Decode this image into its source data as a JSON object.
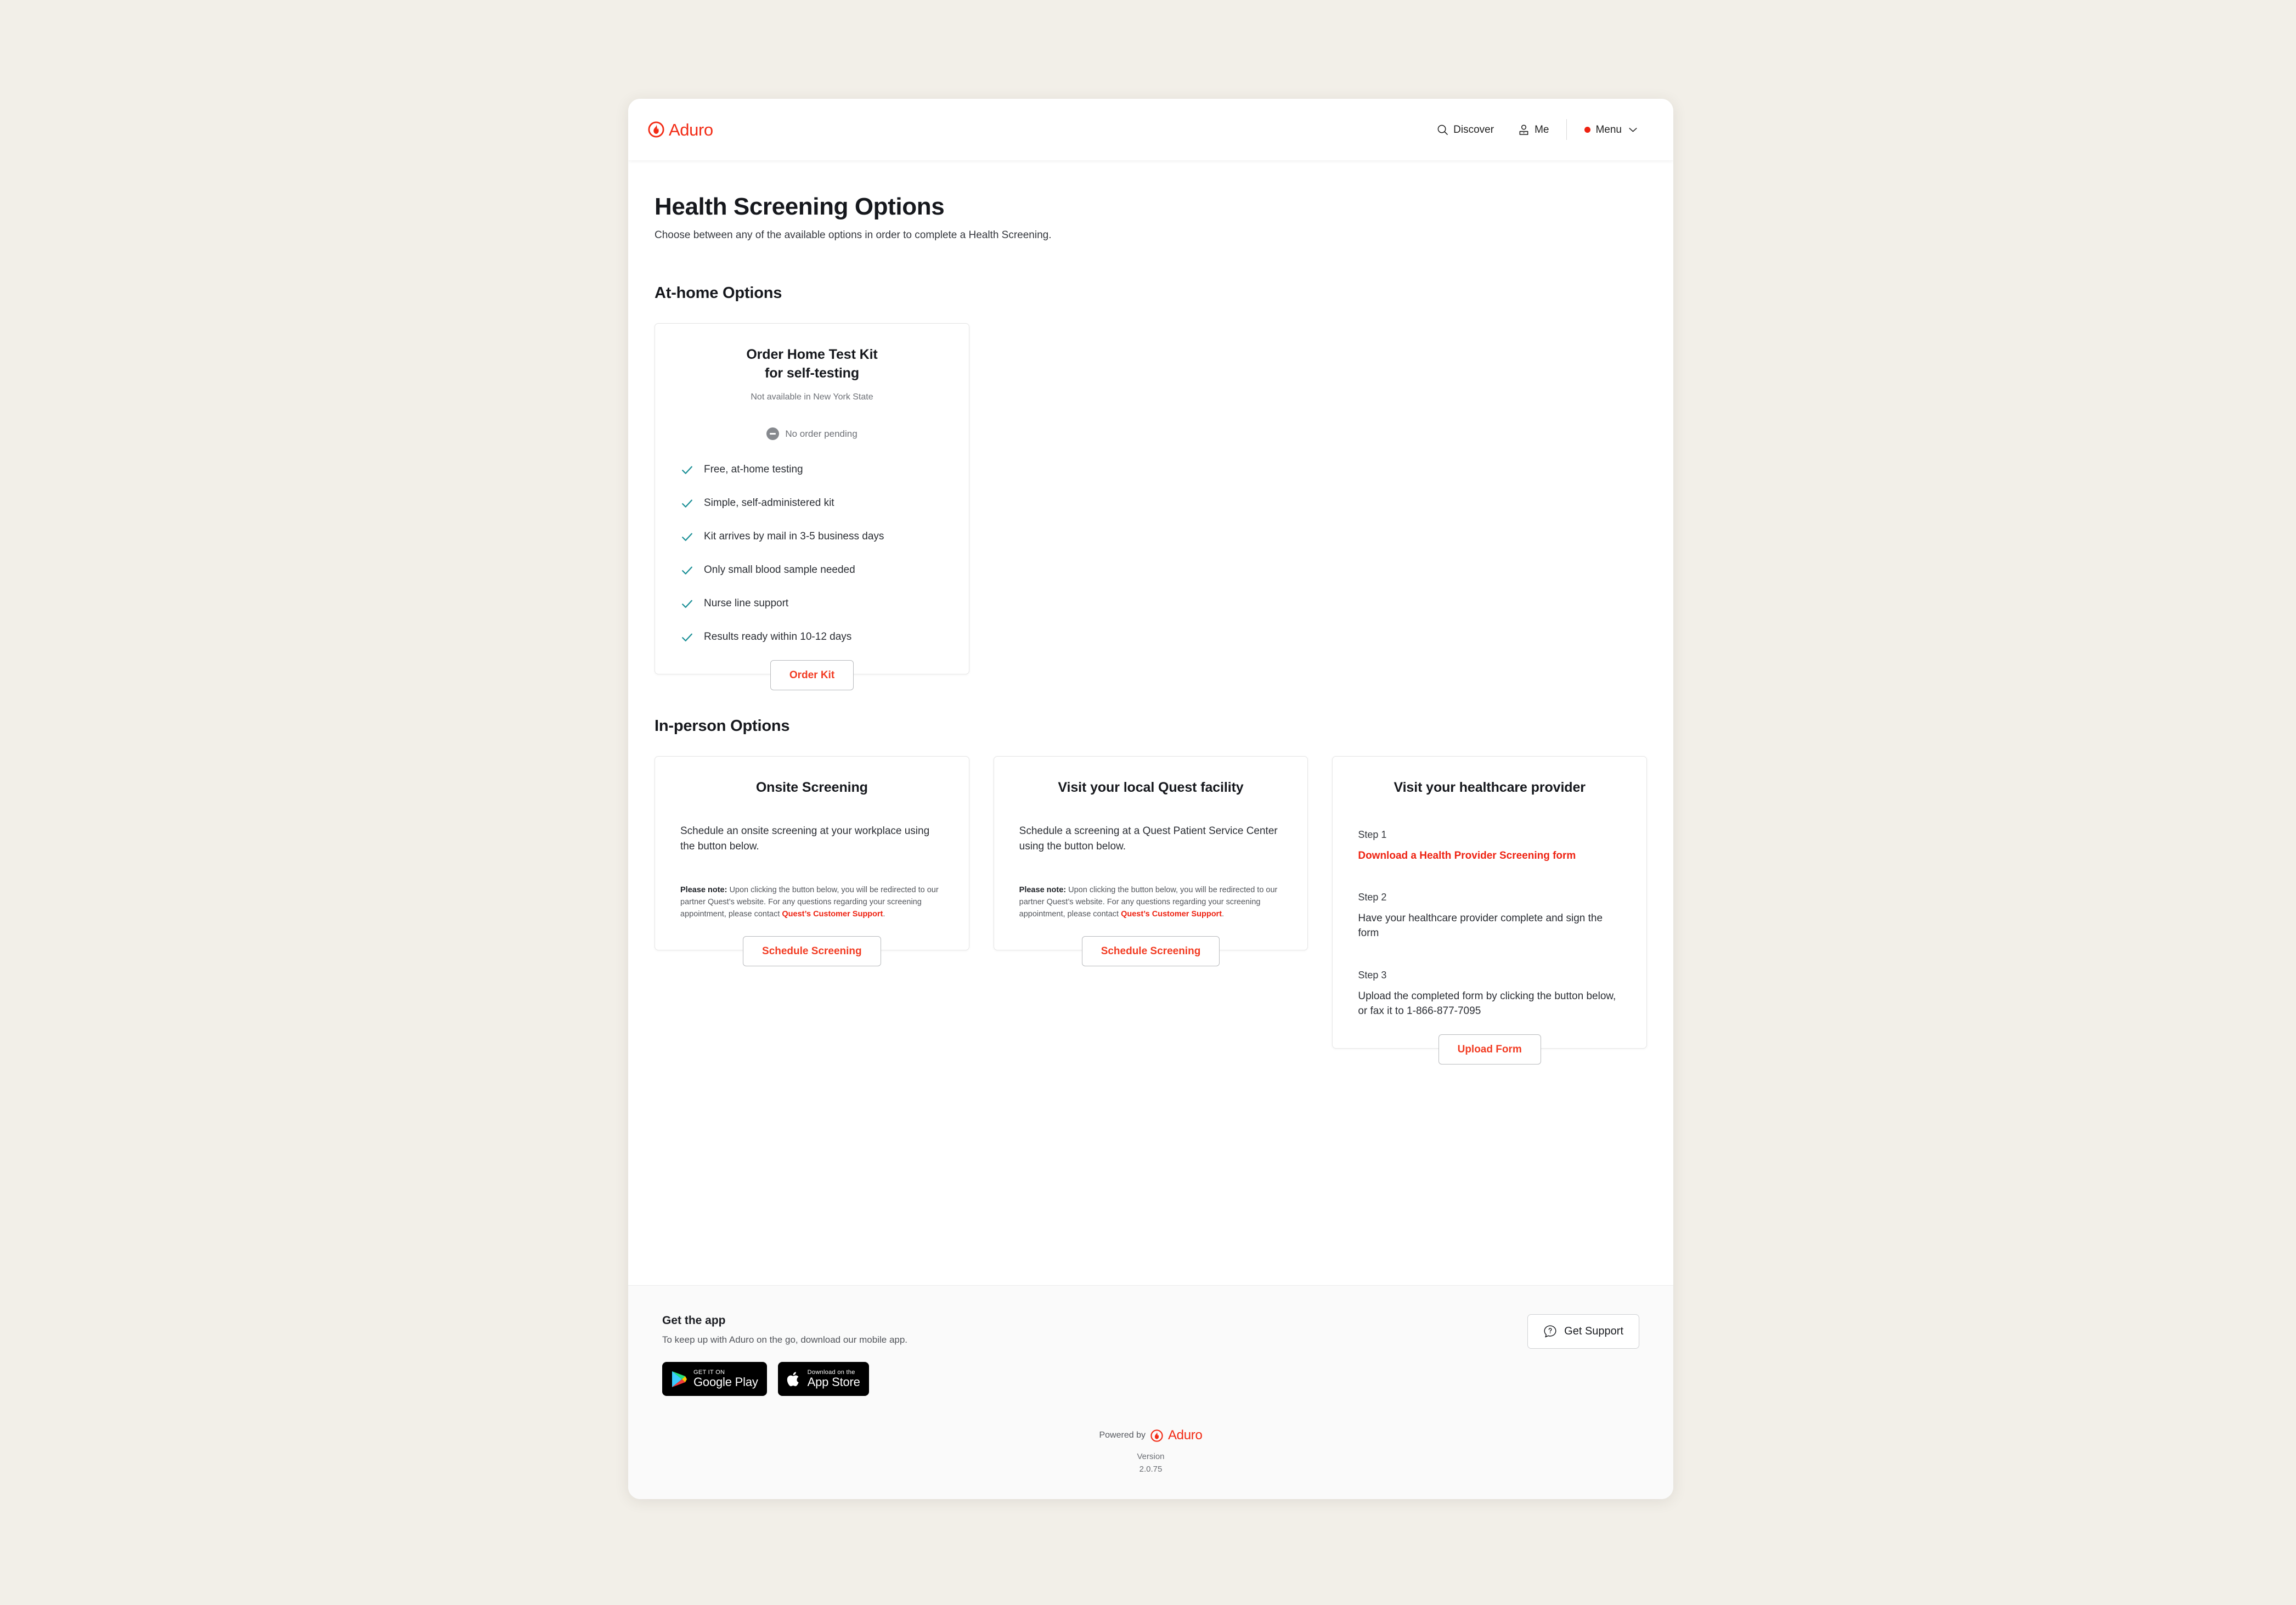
{
  "brand": {
    "name": "Aduro",
    "logo_icon": "aduro-flame-icon",
    "color": "#f22a14"
  },
  "header": {
    "nav": [
      {
        "label": "Discover",
        "icon": "search-icon"
      },
      {
        "label": "Me",
        "icon": "user-icon"
      },
      {
        "label": "Menu",
        "icon": "chevron-down-icon",
        "badge_dot": true
      }
    ]
  },
  "page": {
    "title": "Health Screening Options",
    "subtitle": "Choose between any of the available options in order to complete a Health Screening."
  },
  "sections": {
    "at_home": {
      "heading": "At-home Options"
    },
    "in_person": {
      "heading": "In-person Options"
    }
  },
  "home_kit_card": {
    "title_line1": "Order Home Test Kit",
    "title_line2": "for self-testing",
    "availability_note": "Not available in New York State",
    "status": {
      "icon": "minus-circle-icon",
      "text": "No order pending"
    },
    "features": [
      "Free, at-home testing",
      "Simple, self-administered kit",
      "Kit arrives by mail in 3-5 business days",
      "Only small blood sample needed",
      "Nurse line support",
      "Results ready within 10-12 days"
    ],
    "button": "Order Kit"
  },
  "onsite_card": {
    "title": "Onsite Screening",
    "body": "Schedule an onsite screening at your workplace using the button below.",
    "note_label": "Please note:",
    "note_body": " Upon clicking the button below, you will be redirected to our partner Quest’s website. For any questions regarding your screening appointment, please contact ",
    "note_link": "Quest’s Customer Support",
    "note_end": ".",
    "button": "Schedule Screening"
  },
  "quest_card": {
    "title": "Visit your local Quest facility",
    "body": "Schedule a screening at a Quest Patient Service Center using the button below.",
    "note_label": "Please note:",
    "note_body": " Upon clicking the button below, you will be redirected to our partner Quest’s website. For any questions regarding your screening appointment, please contact ",
    "note_link": "Quest’s Customer Support",
    "note_end": ".",
    "button": "Schedule Screening"
  },
  "provider_card": {
    "title": "Visit your healthcare provider",
    "steps": [
      {
        "label": "Step 1",
        "link_text": "Download a Health Provider Screening form"
      },
      {
        "label": "Step 2",
        "text": "Have your healthcare provider complete and sign the form"
      },
      {
        "label": "Step 3",
        "text": "Upload the completed form by clicking the button below, or fax it to 1-866-877-7095"
      }
    ],
    "button": "Upload Form"
  },
  "footer": {
    "get_app_title": "Get the app",
    "get_app_sub": "To keep up with Aduro on the go, download our mobile app.",
    "badges": [
      {
        "icon": "google-play-icon",
        "top": "GET IT ON",
        "name": "Google Play"
      },
      {
        "icon": "apple-icon",
        "top": "Download on the",
        "name": "App Store"
      }
    ],
    "support_button": {
      "icon": "question-chat-icon",
      "label": "Get Support"
    },
    "powered_by": "Powered by",
    "version_label": "Version",
    "version_number": "2.0.75"
  }
}
